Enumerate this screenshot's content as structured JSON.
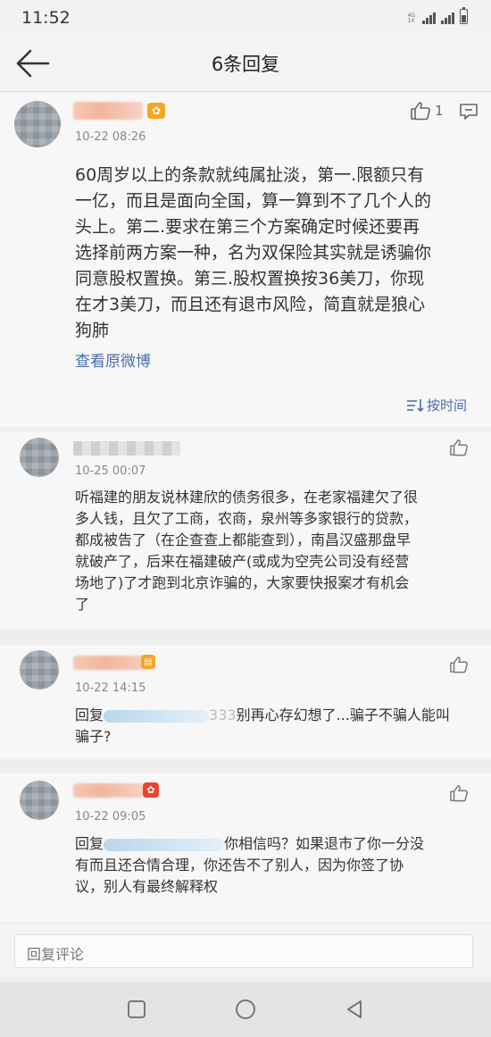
{
  "status_bar": {
    "time": "11:52",
    "network_top": "4G",
    "network_bottom": "1X"
  },
  "header": {
    "title": "6条回复"
  },
  "main_post": {
    "badge": "✿",
    "like_count": "1",
    "timestamp": "10-22 08:26",
    "lines": [
      "60周岁以上的条款就纯属扯淡，第一.限额只有",
      "一亿，而且是面向全国，算一算到不了几个人的",
      "头上。第二.要求在第三个方案确定时候还要再",
      "选择前两方案一种，名为双保险其实就是诱骗你",
      "同意股权置换。第三.股权置换按36美刀，你现",
      "在才3美刀，而且还有退市风险，简直就是狼心",
      "狗肺"
    ],
    "view_original": "查看原微博",
    "sort_label": "按时间"
  },
  "replies": [
    {
      "timestamp": "10-25 00:07",
      "lines": [
        "听福建的朋友说林建欣的债务很多，在老家福建欠了很",
        "多人钱，且欠了工商，农商，泉州等多家银行的贷款，",
        "都成被告了（在企查查上都能查到），南昌汉盛那盘早",
        "就破产了，后来在福建破产(或成为空壳公司没有经营",
        "场地了)了才跑到北京诈骗的，大家要快报案才有机会",
        "了"
      ]
    },
    {
      "timestamp": "10-22 14:15",
      "reply_prefix": "回复",
      "hidden_tail": "333",
      "line1_rest": "别再心存幻想了...骗子不骗人能叫",
      "line2": "骗子?"
    },
    {
      "timestamp": "10-22 09:05",
      "reply_prefix": "回复",
      "line1_rest": "你相信吗？如果退市了你一分没",
      "line2": "有而且还合情合理，你还告不了别人，因为你签了协",
      "line3": "议，别人有最终解释权"
    }
  ],
  "comment": {
    "placeholder": "回复评论"
  },
  "colors": {
    "link": "#4a6ea8",
    "badge_gold": "#f6a623",
    "badge_red": "#e8452c"
  }
}
